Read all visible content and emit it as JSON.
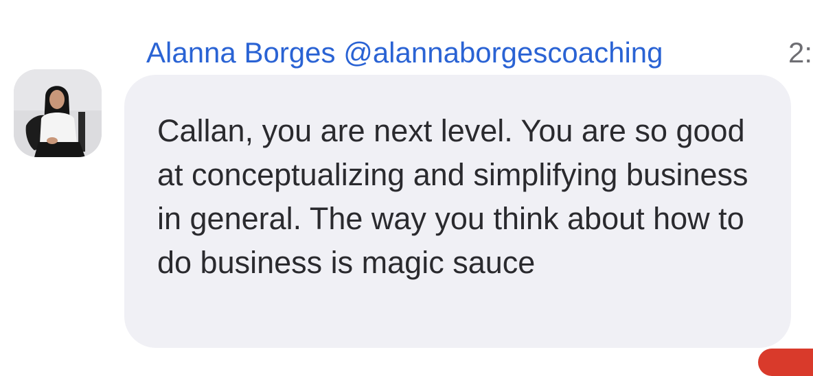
{
  "message": {
    "sender_display": "Alanna Borges @alannaborgescoaching",
    "timestamp": "2:",
    "text": "Callan, you are next level. You are so good at conceptualizing and simplifying business in general. The way you think about how to do business is magic sauce"
  },
  "colors": {
    "sender": "#2a63d4",
    "bubble": "#f0f0f5",
    "text": "#2a2a2e",
    "timestamp": "#6e6e73",
    "badge": "#d93a2b"
  },
  "icons": {
    "avatar": "profile-photo"
  }
}
